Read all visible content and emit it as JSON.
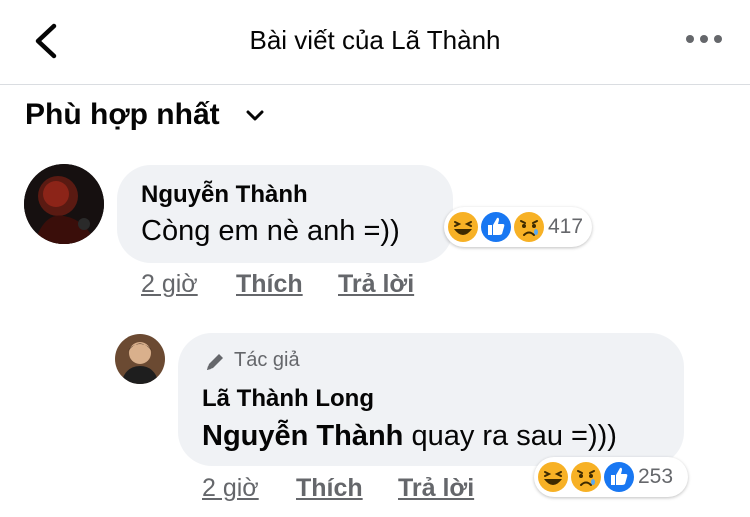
{
  "header": {
    "title": "Bài viết của Lã Thành"
  },
  "sort": {
    "label": "Phù hợp nhất"
  },
  "comments": [
    {
      "name": "Nguyễn Thành",
      "text": "Còng em nè anh =))",
      "reaction_count": "417",
      "time": "2 giờ",
      "like": "Thích",
      "reply": "Trả lời"
    },
    {
      "badge": "Tác giả",
      "name": "Lã Thành Long",
      "mention": "Nguyễn Thành",
      "text": "quay ra sau =)))",
      "reaction_count": "253",
      "time": "2 giờ",
      "like": "Thích",
      "reply": "Trả lời"
    }
  ],
  "colors": {
    "bubble": "#f0f2f5",
    "secondary": "#65676b",
    "like_blue": "#1877f2",
    "emoji_yellow": "#f7b125"
  },
  "icons": [
    "back-chevron-icon",
    "more-options-icon",
    "chevron-down-icon",
    "pen-icon",
    "haha-reaction-icon",
    "like-reaction-icon",
    "sad-reaction-icon"
  ]
}
